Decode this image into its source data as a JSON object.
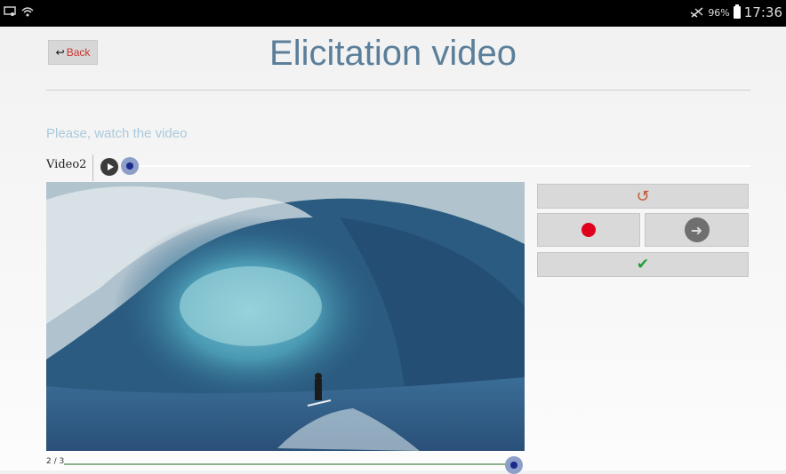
{
  "status_bar": {
    "battery_percent": "96%",
    "time": "17:36"
  },
  "header": {
    "back_label": "Back",
    "title": "Elicitation video"
  },
  "instruction": "Please, watch the video",
  "player": {
    "video_name": "Video2",
    "top_progress": 0.0,
    "counter": "2 / 3",
    "bottom_progress": 1.0
  },
  "controls": {
    "reset_icon": "rotate-left-icon",
    "record_icon": "record-icon",
    "next_icon": "arrow-right-circle-icon",
    "confirm_icon": "check-icon"
  },
  "colors": {
    "title": "#5b7f9a",
    "instruction": "#a9c9dc",
    "record": "#e0001b",
    "confirm": "#1e9e3a"
  }
}
